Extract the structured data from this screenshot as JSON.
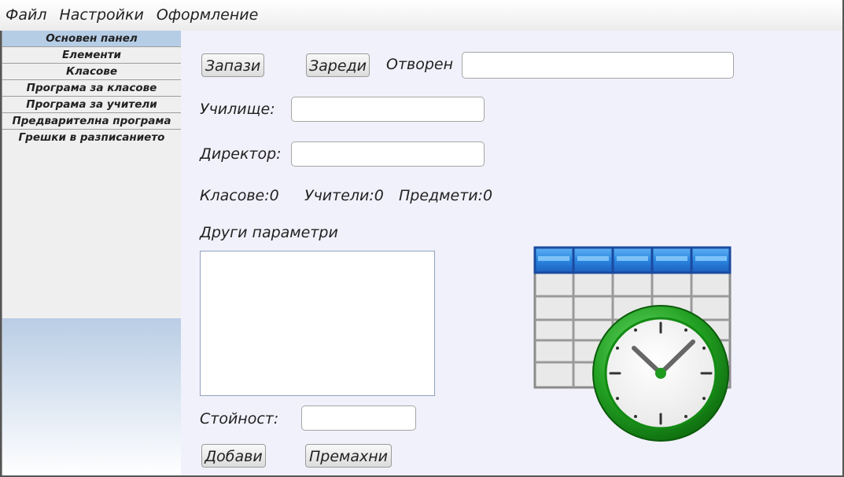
{
  "menu": {
    "file": "Файл",
    "settings": "Настройки",
    "appearance": "Оформление"
  },
  "sidebar": {
    "items": [
      {
        "label": "Основен панел",
        "active": true
      },
      {
        "label": "Елементи"
      },
      {
        "label": "Класове"
      },
      {
        "label": "Програма за класове"
      },
      {
        "label": "Програма за учители"
      },
      {
        "label": "Предварителна програма"
      },
      {
        "label": "Грешки в разписанието"
      }
    ]
  },
  "main": {
    "save_label": "Запази",
    "load_label": "Зареди",
    "opened_label": "Отворен",
    "opened_value": "",
    "school_label": "Училище:",
    "school_value": "",
    "director_label": "Директор:",
    "director_value": "",
    "classes_count": "Класове:0",
    "teachers_count": "Учители:0",
    "subjects_count": "Предмети:0",
    "other_params_label": "Други параметри",
    "value_label": "Стойност:",
    "value_value": "",
    "add_label": "Добави",
    "remove_label": "Премахни"
  },
  "colors": {
    "accent": "#b6cde6",
    "clock_green": "#2aa52a",
    "table_header_blue": "#1e6fd0"
  },
  "icons": {
    "schedule_clock": "schedule-clock-icon"
  }
}
